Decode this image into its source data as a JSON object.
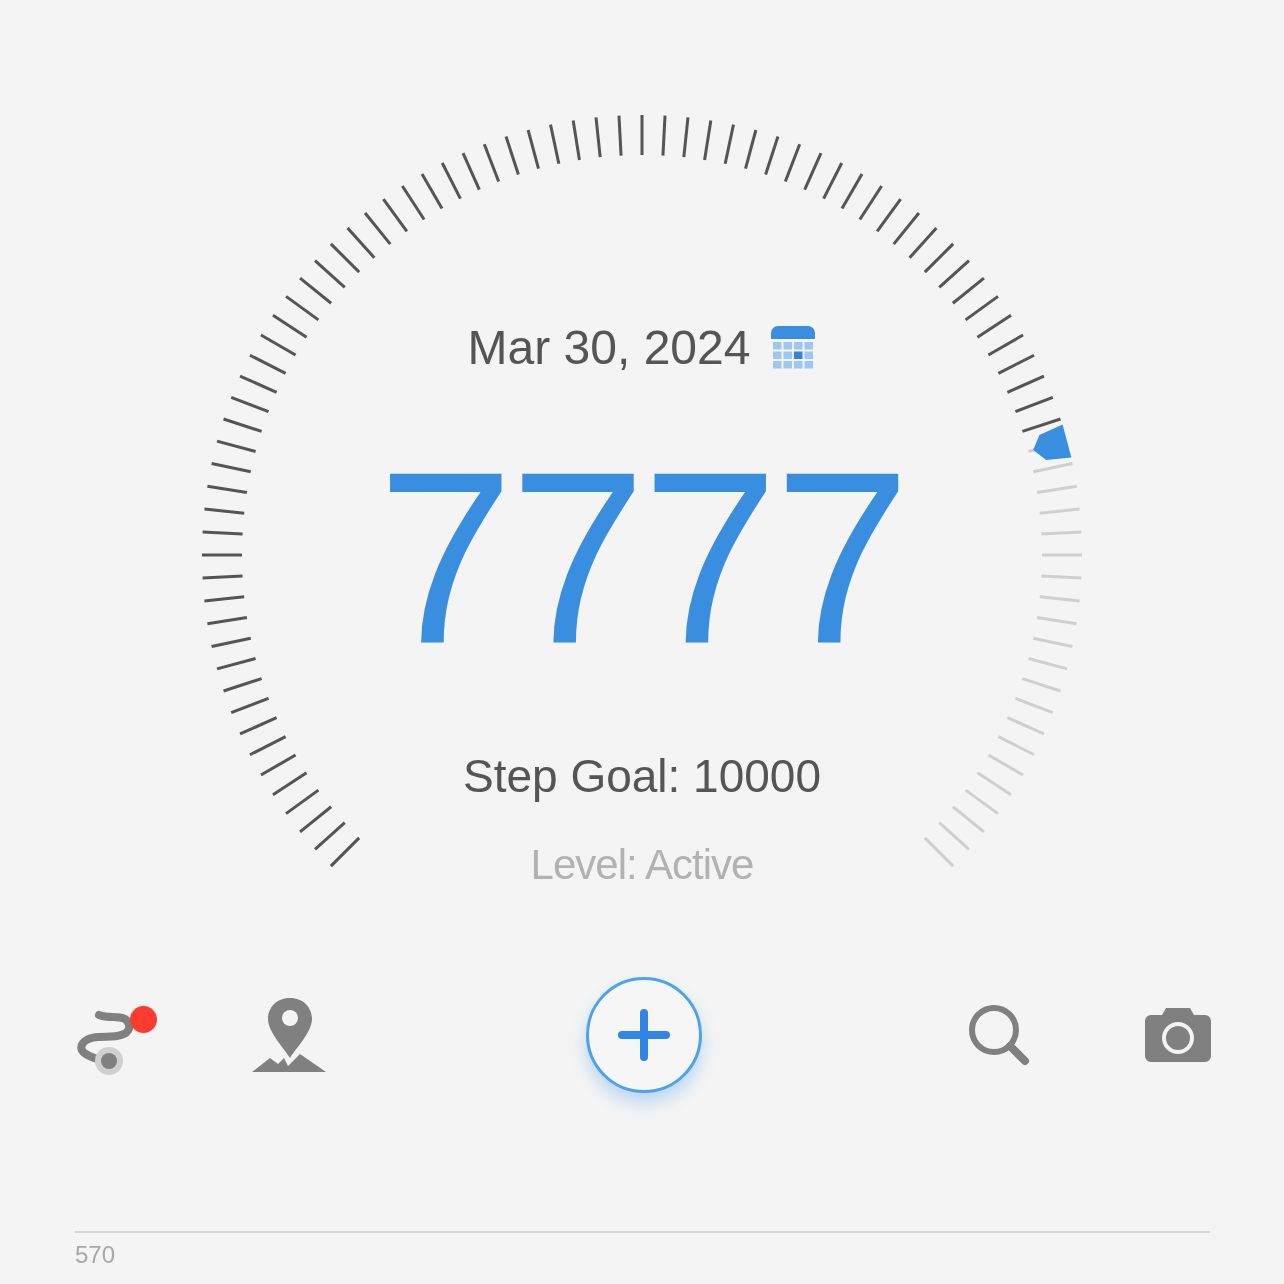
{
  "date": "Mar 30, 2024",
  "steps": "7777",
  "step_goal": "Step Goal: 10000",
  "activity_level": "Level: Active",
  "toolbar": {
    "route_alert": true
  },
  "footer": {
    "label": "570"
  }
}
